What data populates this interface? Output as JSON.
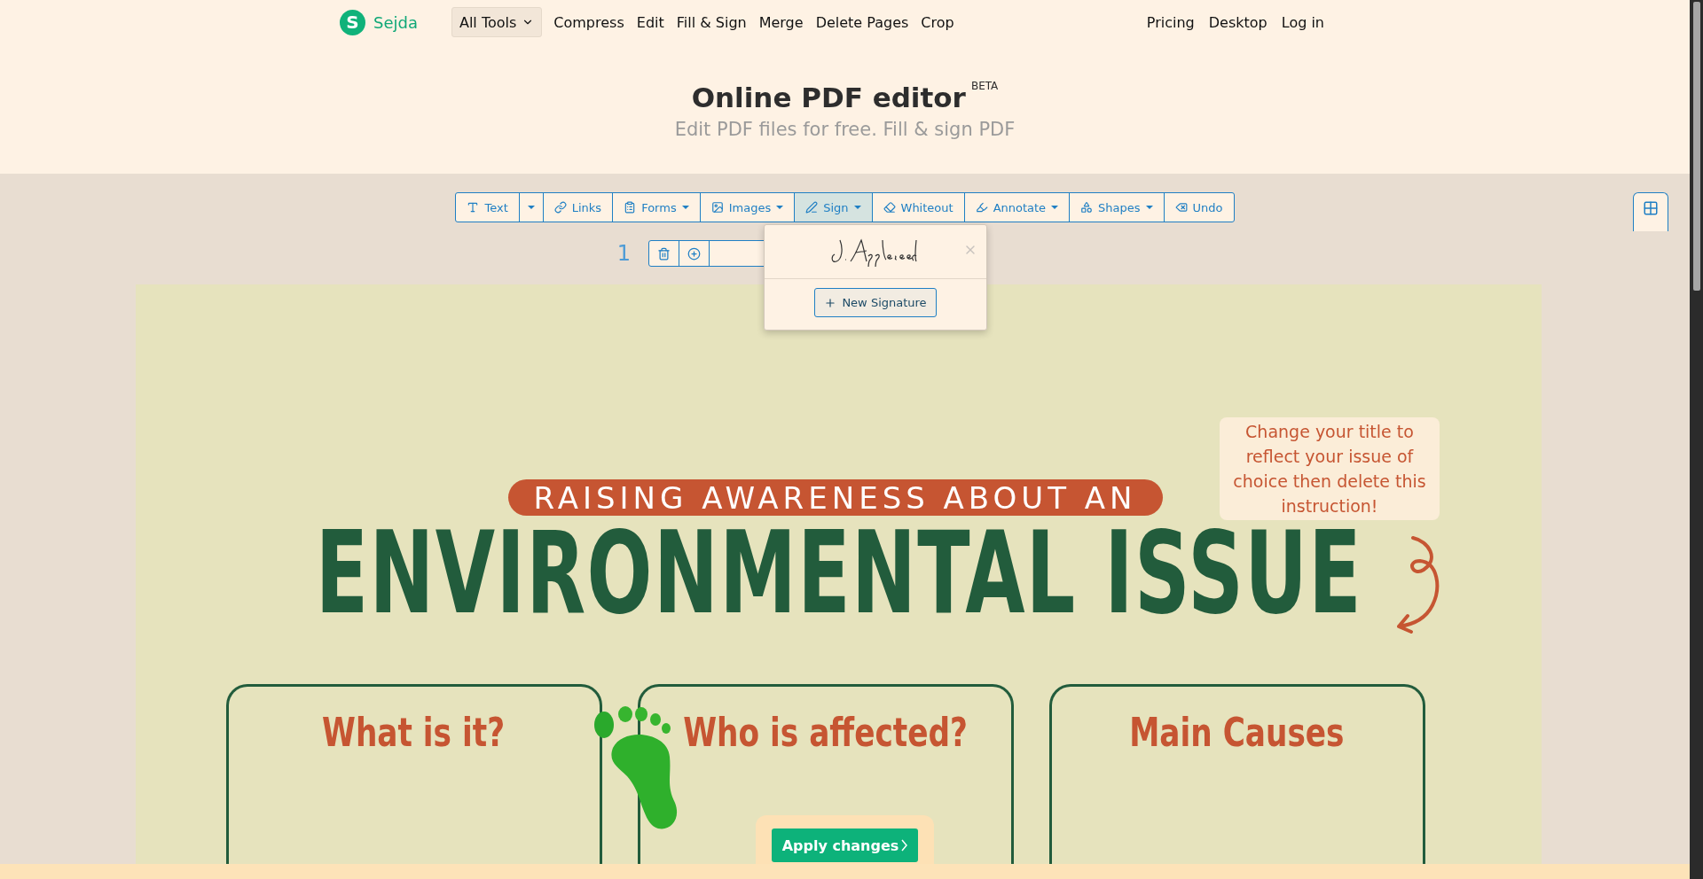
{
  "nav": {
    "logo": "S",
    "brand": "Sejda",
    "all_tools": "All Tools",
    "links": [
      "Compress",
      "Edit",
      "Fill & Sign",
      "Merge",
      "Delete Pages",
      "Crop"
    ],
    "right_links": [
      "Pricing",
      "Desktop",
      "Log in"
    ]
  },
  "header": {
    "title": "Online PDF editor",
    "badge": "BETA",
    "subtitle": "Edit PDF files for free. Fill & sign PDF"
  },
  "toolbar": [
    {
      "kind": "text",
      "label": "Text",
      "dropdown": false,
      "selected": false
    },
    {
      "kind": "caret",
      "dropdown": true,
      "selected": false
    },
    {
      "kind": "link",
      "label": "Links",
      "dropdown": false,
      "selected": false
    },
    {
      "kind": "forms",
      "label": "Forms",
      "dropdown": true,
      "selected": false
    },
    {
      "kind": "image",
      "label": "Images",
      "dropdown": true,
      "selected": false
    },
    {
      "kind": "sign",
      "label": "Sign",
      "dropdown": true,
      "selected": true
    },
    {
      "kind": "whiteout",
      "label": "Whiteout",
      "dropdown": false,
      "selected": false
    },
    {
      "kind": "annotate",
      "label": "Annotate",
      "dropdown": true,
      "selected": false
    },
    {
      "kind": "shapes",
      "label": "Shapes",
      "dropdown": true,
      "selected": false
    },
    {
      "kind": "undo",
      "label": "Undo",
      "dropdown": false,
      "selected": false
    }
  ],
  "page_number": "1",
  "sign_menu": {
    "open": true,
    "new_button": "New Signature"
  },
  "document": {
    "banner": "RAISING AWARENESS ABOUT AN",
    "title": "ENVIRONMENTAL ISSUE",
    "note": "Change your title to reflect your issue of choice then delete this instruction!",
    "cards": [
      "What is it?",
      "Who is affected?",
      "Main Causes"
    ]
  },
  "apply_button": "Apply changes"
}
